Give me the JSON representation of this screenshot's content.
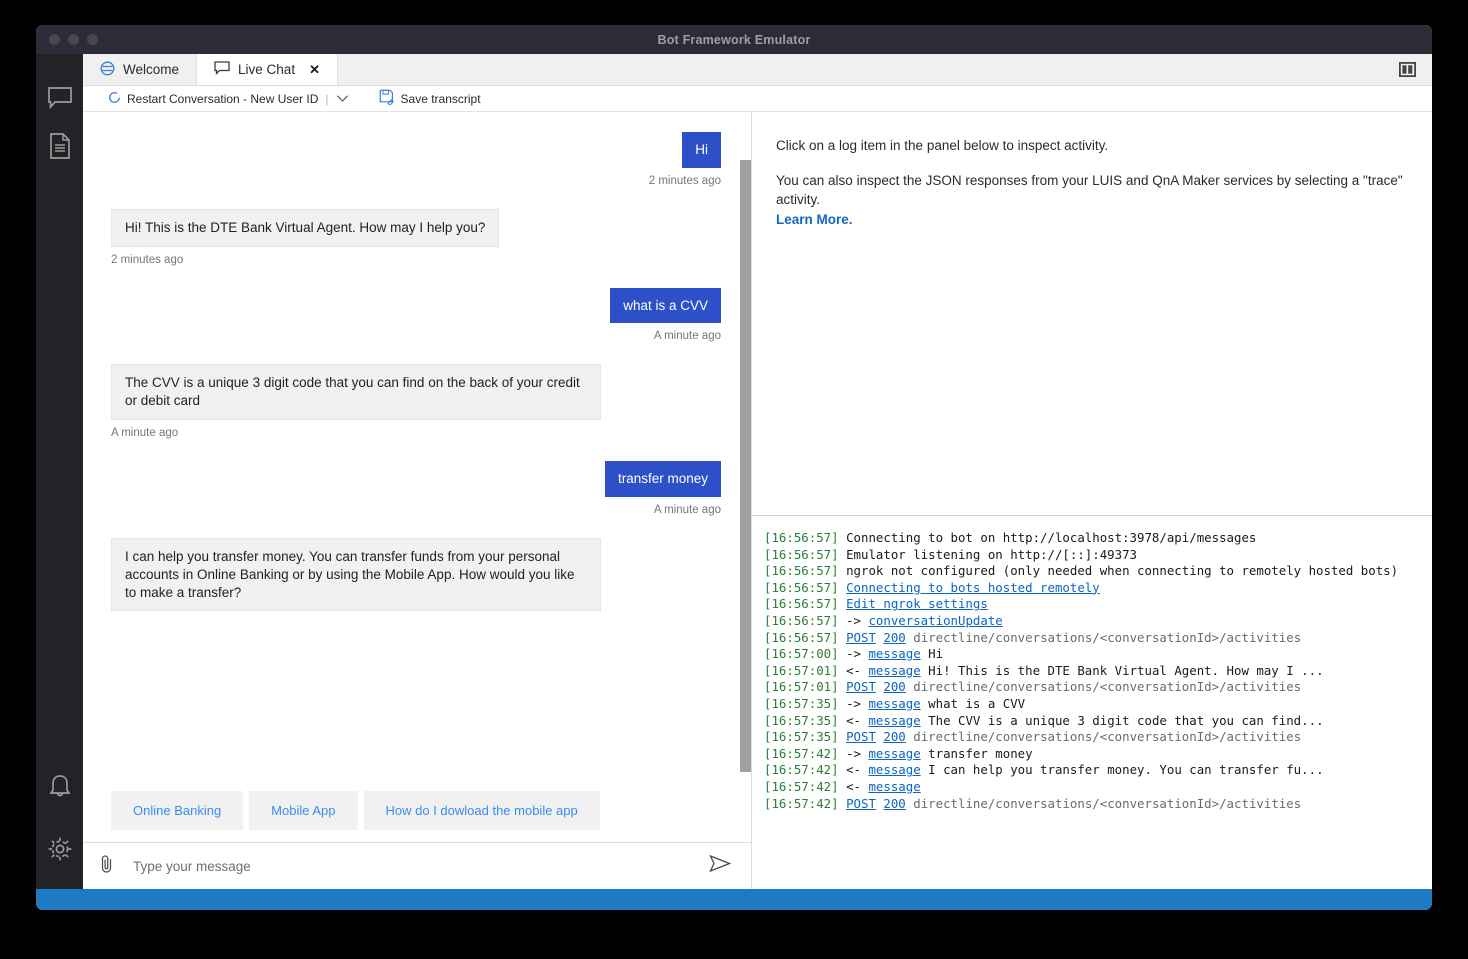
{
  "window": {
    "title": "Bot Framework Emulator",
    "traffic_lights": [
      "close",
      "minimize",
      "maximize"
    ]
  },
  "left_rail": {
    "items": [
      {
        "icon": "chat-bubble-icon",
        "label": "Live Chat"
      },
      {
        "icon": "document-icon",
        "label": "Transcripts"
      }
    ],
    "bottom_items": [
      {
        "icon": "bell-icon",
        "label": "Notifications"
      },
      {
        "icon": "gear-icon",
        "label": "Settings"
      }
    ]
  },
  "tabs": [
    {
      "label": "Welcome",
      "icon": "welcome-icon",
      "active": false,
      "closable": false
    },
    {
      "label": "Live Chat",
      "icon": "chat-bubble-icon",
      "active": true,
      "closable": true,
      "close_glyph": "✕"
    }
  ],
  "panel_toggle": {
    "icon": "split-panel-icon",
    "label": "Toggle panel layout"
  },
  "toolbar": {
    "restart_label": "Restart Conversation - New User ID",
    "restart_icon": "restart-circle-icon",
    "separator": "|",
    "chevron": "⌄",
    "save_transcript_label": "Save transcript",
    "save_transcript_icon": "save-disk-icon"
  },
  "chat": {
    "messages": [
      {
        "from": "user",
        "text": "Hi",
        "timestamp": "2 minutes ago"
      },
      {
        "from": "bot",
        "text": "Hi! This is the DTE Bank Virtual Agent. How may I help you?",
        "timestamp": "2 minutes ago"
      },
      {
        "from": "user",
        "text": "what is a CVV",
        "timestamp": "A minute ago"
      },
      {
        "from": "bot",
        "text": "The CVV is a unique 3 digit code that you can find on the back of your credit or debit card",
        "timestamp": "A minute ago"
      },
      {
        "from": "user",
        "text": "transfer money",
        "timestamp": "A minute ago"
      },
      {
        "from": "bot",
        "text": "I can help you transfer money. You can transfer funds from your personal accounts in Online Banking or by using the Mobile App. How would you like to make a transfer?",
        "timestamp": ""
      }
    ],
    "suggested_actions": [
      "Online Banking",
      "Mobile App",
      "How do I dowload the mobile app"
    ],
    "composer": {
      "attach_icon": "paperclip-icon",
      "placeholder": "Type your message",
      "value": "",
      "send_icon": "send-arrow-icon"
    }
  },
  "inspector": {
    "line1": "Click on a log item in the panel below to inspect activity.",
    "line2": "You can also inspect the JSON responses from your LUIS and QnA Maker services by selecting a \"trace\" activity.",
    "learn_more": "Learn More."
  },
  "log": {
    "lines": [
      {
        "ts": "[16:56:57]",
        "segments": [
          {
            "t": "Connecting to bot on http://localhost:3978/api/messages",
            "style": "plain"
          }
        ]
      },
      {
        "ts": "[16:56:57]",
        "segments": [
          {
            "t": "Emulator listening on http://[::]:49373",
            "style": "plain"
          }
        ]
      },
      {
        "ts": "[16:56:57]",
        "segments": [
          {
            "t": "ngrok not configured (only needed when connecting to remotely hosted bots)",
            "style": "plain"
          }
        ]
      },
      {
        "ts": "[16:56:57]",
        "segments": [
          {
            "t": "Connecting to bots hosted remotely",
            "style": "link"
          }
        ]
      },
      {
        "ts": "[16:56:57]",
        "segments": [
          {
            "t": "Edit ngrok settings",
            "style": "link"
          }
        ]
      },
      {
        "ts": "[16:56:57]",
        "segments": [
          {
            "t": "->",
            "style": "arrow"
          },
          {
            "t": "conversationUpdate",
            "style": "link"
          }
        ]
      },
      {
        "ts": "[16:56:57]",
        "segments": [
          {
            "t": "POST",
            "style": "link"
          },
          {
            "t": "200",
            "style": "link"
          },
          {
            "t": "directline/conversations/<conversationId>/activities",
            "style": "path"
          }
        ]
      },
      {
        "ts": "[16:57:00]",
        "segments": [
          {
            "t": "->",
            "style": "arrow"
          },
          {
            "t": "message",
            "style": "link"
          },
          {
            "t": "Hi",
            "style": "plain"
          }
        ]
      },
      {
        "ts": "[16:57:01]",
        "segments": [
          {
            "t": "<-",
            "style": "arrow"
          },
          {
            "t": "message",
            "style": "link"
          },
          {
            "t": "Hi! This is the DTE Bank Virtual Agent. How may I ...",
            "style": "plain"
          }
        ]
      },
      {
        "ts": "[16:57:01]",
        "segments": [
          {
            "t": "POST",
            "style": "link"
          },
          {
            "t": "200",
            "style": "link"
          },
          {
            "t": "directline/conversations/<conversationId>/activities",
            "style": "path"
          }
        ]
      },
      {
        "ts": "[16:57:35]",
        "segments": [
          {
            "t": "->",
            "style": "arrow"
          },
          {
            "t": "message",
            "style": "link"
          },
          {
            "t": "what is a CVV",
            "style": "plain"
          }
        ]
      },
      {
        "ts": "[16:57:35]",
        "segments": [
          {
            "t": "<-",
            "style": "arrow"
          },
          {
            "t": "message",
            "style": "link"
          },
          {
            "t": "The CVV is a unique 3 digit code that you can find...",
            "style": "plain"
          }
        ]
      },
      {
        "ts": "[16:57:35]",
        "segments": [
          {
            "t": "POST",
            "style": "link"
          },
          {
            "t": "200",
            "style": "link"
          },
          {
            "t": "directline/conversations/<conversationId>/activities",
            "style": "path"
          }
        ]
      },
      {
        "ts": "[16:57:42]",
        "segments": [
          {
            "t": "->",
            "style": "arrow"
          },
          {
            "t": "message",
            "style": "link"
          },
          {
            "t": "transfer money",
            "style": "plain"
          }
        ]
      },
      {
        "ts": "[16:57:42]",
        "segments": [
          {
            "t": "<-",
            "style": "arrow"
          },
          {
            "t": "message",
            "style": "link"
          },
          {
            "t": "I can help you transfer money. You can transfer fu...",
            "style": "plain"
          }
        ]
      },
      {
        "ts": "[16:57:42]",
        "segments": [
          {
            "t": "<-",
            "style": "arrow"
          },
          {
            "t": "message",
            "style": "link"
          }
        ]
      },
      {
        "ts": "[16:57:42]",
        "segments": [
          {
            "t": "POST",
            "style": "link"
          },
          {
            "t": "200",
            "style": "link"
          },
          {
            "t": "directline/conversations/<conversationId>/activities",
            "style": "path"
          }
        ]
      }
    ]
  },
  "colors": {
    "user_bubble": "#2b50c8",
    "bot_bubble": "#f1f1f1",
    "status_bar": "#1f7ac4",
    "link": "#0b65c2",
    "timestamp_green": "#2e7d32",
    "title_bar": "#2e2a38",
    "rail": "#232226",
    "suggested_action_text": "#3b8cf0"
  }
}
